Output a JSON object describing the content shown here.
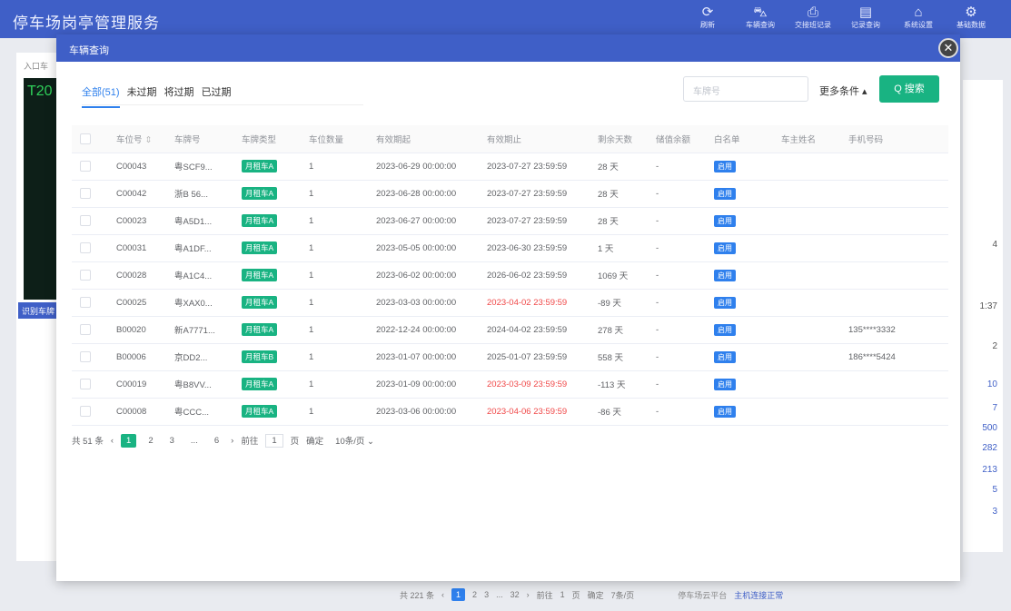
{
  "app": {
    "title": "停车场岗亭管理服务",
    "tools": [
      {
        "icon": "refresh-icon",
        "glyph": "⟳",
        "label": "刷新"
      },
      {
        "icon": "car-icon",
        "glyph": "⛍",
        "label": "车辆查询"
      },
      {
        "icon": "print-icon",
        "glyph": "⎙",
        "label": "交接班记录"
      },
      {
        "icon": "doc-icon",
        "glyph": "▤",
        "label": "记录查询"
      },
      {
        "icon": "bell-icon",
        "glyph": "⌂",
        "label": "系统设置"
      },
      {
        "icon": "gear-icon",
        "glyph": "⚙",
        "label": "基础数据"
      }
    ]
  },
  "background": {
    "entry_label": "入口车",
    "plate_fragment": "T20",
    "left_button": "识别车牌",
    "right_values": [
      "4",
      "1:37",
      "2",
      "10",
      "7",
      "500",
      "282",
      "213",
      "5",
      "3"
    ],
    "bottom": {
      "total": "共 221 条",
      "pages": [
        "1",
        "2",
        "3",
        "...",
        "32"
      ],
      "goto": "前往",
      "goto_value": "1",
      "page_suffix": "页",
      "confirm": "确定",
      "page_size": "7条/页",
      "platform": "停车场云平台",
      "network": "主机连接正常"
    }
  },
  "modal": {
    "title": "车辆查询",
    "close": "✕",
    "tabs": [
      {
        "label": "全部(51)",
        "active": true
      },
      {
        "label": "未过期",
        "active": false
      },
      {
        "label": "将过期",
        "active": false
      },
      {
        "label": "已过期",
        "active": false
      }
    ],
    "search": {
      "placeholder": "车牌号",
      "more_conditions": "更多条件 ▴",
      "button": "Q 搜索"
    },
    "table": {
      "columns": [
        "",
        "车位号",
        "车牌号",
        "车牌类型",
        "车位数量",
        "有效期起",
        "有效期止",
        "剩余天数",
        "储值余额",
        "白名单",
        "车主姓名",
        "手机号码"
      ],
      "rows": [
        {
          "spot": "C00043",
          "plate": "粤SCF9...",
          "type": "月租车A",
          "count": "1",
          "start": "2023-06-29 00:00:00",
          "end": "2023-07-27 23:59:59",
          "days": "28 天",
          "balance": "-",
          "whitelist": "启用",
          "owner": "",
          "phone": "",
          "expired": false
        },
        {
          "spot": "C00042",
          "plate": "浙B 56...",
          "type": "月租车A",
          "count": "1",
          "start": "2023-06-28 00:00:00",
          "end": "2023-07-27 23:59:59",
          "days": "28 天",
          "balance": "-",
          "whitelist": "启用",
          "owner": "",
          "phone": "",
          "expired": false
        },
        {
          "spot": "C00023",
          "plate": "粤A5D1...",
          "type": "月租车A",
          "count": "1",
          "start": "2023-06-27 00:00:00",
          "end": "2023-07-27 23:59:59",
          "days": "28 天",
          "balance": "-",
          "whitelist": "启用",
          "owner": "",
          "phone": "",
          "expired": false
        },
        {
          "spot": "C00031",
          "plate": "粤A1DF...",
          "type": "月租车A",
          "count": "1",
          "start": "2023-05-05 00:00:00",
          "end": "2023-06-30 23:59:59",
          "days": "1 天",
          "balance": "-",
          "whitelist": "启用",
          "owner": "",
          "phone": "",
          "expired": false
        },
        {
          "spot": "C00028",
          "plate": "粤A1C4...",
          "type": "月租车A",
          "count": "1",
          "start": "2023-06-02 00:00:00",
          "end": "2026-06-02 23:59:59",
          "days": "1069 天",
          "balance": "-",
          "whitelist": "启用",
          "owner": "",
          "phone": "",
          "expired": false
        },
        {
          "spot": "C00025",
          "plate": "粤XAX0...",
          "type": "月租车A",
          "count": "1",
          "start": "2023-03-03 00:00:00",
          "end": "2023-04-02 23:59:59",
          "days": "-89 天",
          "balance": "-",
          "whitelist": "启用",
          "owner": "",
          "phone": "",
          "expired": true
        },
        {
          "spot": "B00020",
          "plate": "新A7771...",
          "type": "月租车A",
          "count": "1",
          "start": "2022-12-24 00:00:00",
          "end": "2024-04-02 23:59:59",
          "days": "278 天",
          "balance": "-",
          "whitelist": "启用",
          "owner": "",
          "phone": "135****3332",
          "expired": false
        },
        {
          "spot": "B00006",
          "plate": "京DD2...",
          "type": "月租车B",
          "count": "1",
          "start": "2023-01-07 00:00:00",
          "end": "2025-01-07 23:59:59",
          "days": "558 天",
          "balance": "-",
          "whitelist": "启用",
          "owner": "",
          "phone": "186****5424",
          "expired": false
        },
        {
          "spot": "C00019",
          "plate": "粤B8VV...",
          "type": "月租车A",
          "count": "1",
          "start": "2023-01-09 00:00:00",
          "end": "2023-03-09 23:59:59",
          "days": "-113 天",
          "balance": "-",
          "whitelist": "启用",
          "owner": "",
          "phone": "",
          "expired": true
        },
        {
          "spot": "C00008",
          "plate": "粤CCC...",
          "type": "月租车A",
          "count": "1",
          "start": "2023-03-06 00:00:00",
          "end": "2023-04-06 23:59:59",
          "days": "-86 天",
          "balance": "-",
          "whitelist": "启用",
          "owner": "",
          "phone": "",
          "expired": true
        }
      ]
    },
    "pager": {
      "total": "共 51 条",
      "pages": [
        "1",
        "2",
        "3",
        "...",
        "6"
      ],
      "goto": "前往",
      "goto_value": "1",
      "page_suffix": "页",
      "confirm": "确定",
      "page_size": "10条/页 ⌄"
    }
  }
}
